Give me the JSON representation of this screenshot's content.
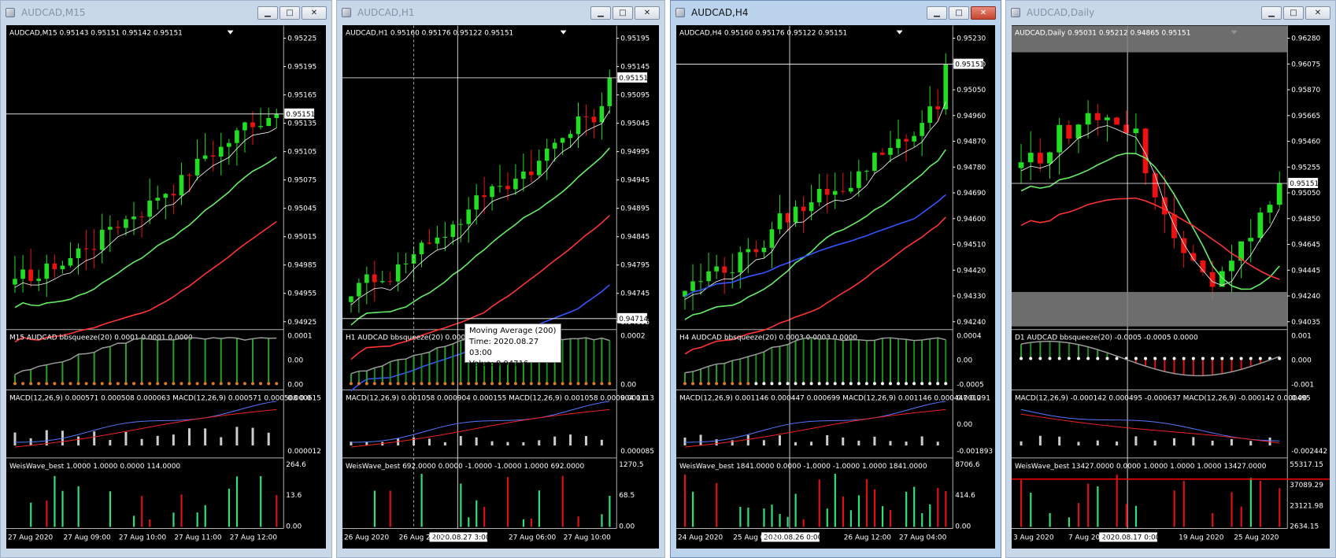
{
  "windows": [
    {
      "title": "AUDCAD,M15",
      "active": false,
      "header": "AUDCAD,M15  0.95143 0.95151 0.95142 0.95151",
      "price_ticks": [
        "0.95225",
        "0.95195",
        "0.95165",
        "0.95135",
        "0.95105",
        "0.95075",
        "0.95045",
        "0.95015",
        "0.94985",
        "0.94955",
        "0.94925"
      ],
      "price_min": 0.9491,
      "price_max": 0.9524,
      "current_price": "0.95151",
      "current_value": 0.95151,
      "indicator_label": "M15 AUDCAD bbsqueeze(20) 0.0001 0.0001 0.0000",
      "indicator_ticks": [
        "0.0001",
        "0.00",
        "0.00"
      ],
      "macd_label": "MACD(12,26,9) 0.000571 0.000508 0.000063  MACD(12,26,9) 0.000571 0.000508 0.0",
      "macd_ticks": [
        "0.000615",
        "0.000012"
      ],
      "weis_label": "WeisWave_best 1.0000 1.0000 0.0000 114.0000",
      "weis_ticks": [
        "264.6",
        "13.6",
        "0.00"
      ],
      "time_labels": [
        "27 Aug 2020",
        "27 Aug 09:00",
        "27 Aug 10:00",
        "27 Aug 11:00",
        "27 Aug 12:00"
      ],
      "crosshair_time": "",
      "trend": "up"
    },
    {
      "title": "AUDCAD,H1",
      "active": false,
      "header": "AUDCAD,H1  0.95160 0.95176 0.95122 0.95151",
      "price_ticks": [
        "0.95195",
        "0.95145",
        "0.95095",
        "0.95045",
        "0.94995",
        "0.94945",
        "0.94895",
        "0.94845",
        "0.94795",
        "0.94745",
        "0.94695"
      ],
      "price_min": 0.9468,
      "price_max": 0.9523,
      "current_price": "0.95151",
      "current_value": 0.95151,
      "crosshair_price": "0.94714",
      "indicator_label": "H1 AUDCAD bbsqueeze(20) 0.0002",
      "indicator_ticks": [
        "0.0002",
        "0.00"
      ],
      "macd_label": "MACD(12,26,9) 0.001058 0.000904 0.000155  MACD(12,26,9) 0.001058 0.000904 0.0",
      "macd_ticks": [
        "0.001113",
        "0.000085"
      ],
      "weis_label": "WeisWave_best 692.0000 0.0000 -1.0000 -1.0000 1.0000 692.0000",
      "weis_ticks": [
        "1270.5",
        "68.5",
        "0.00"
      ],
      "time_labels": [
        "26 Aug 2020",
        "26 Aug 22:00",
        "",
        "27 Aug 06:00",
        "27 Aug 10:00"
      ],
      "crosshair_time": "2020.08.27 3:00",
      "tooltip": {
        "line1": "Moving Average (200)",
        "line2": "Time: 2020.08.27 03:00",
        "line3": "Value: 0.94716"
      },
      "trend": "up"
    },
    {
      "title": "AUDCAD,H4",
      "active": true,
      "header": "AUDCAD,H4  0.95160 0.95176 0.95122 0.95151",
      "price_ticks": [
        "0.95230",
        "0.95140",
        "0.95050",
        "0.94960",
        "0.94870",
        "0.94780",
        "0.94690",
        "0.94600",
        "0.94510",
        "0.94420",
        "0.94330",
        "0.94240"
      ],
      "price_min": 0.9422,
      "price_max": 0.9525,
      "current_price": "0.95151",
      "current_value": 0.95151,
      "indicator_label": "H4 AUDCAD bbsqueeze(20) 0.0003 0.0003 0.0000",
      "indicator_ticks": [
        "0.0004",
        "0.00",
        "-0.0005"
      ],
      "macd_label": "MACD(12,26,9) 0.001146 0.000447 0.000699  MACD(12,26,9) 0.001146 0.000447 0.0",
      "macd_ticks": [
        "0.001291",
        "0.00",
        "-0.001893"
      ],
      "weis_label": "WeisWave_best 1841.0000 0.0000 -1.0000 -1.0000 1.0000 1841.0000",
      "weis_ticks": [
        "8706.6",
        "414.6",
        "0.00"
      ],
      "time_labels": [
        "24 Aug 2020",
        "25 Aug 04:00",
        "",
        "26 Aug 12:00",
        "27 Aug 04:00"
      ],
      "crosshair_time": "2020.08.26 0:00",
      "trend": "up"
    },
    {
      "title": "AUDCAD,Daily",
      "active": false,
      "header": "AUDCAD,Daily  0.95031 0.95212 0.94865 0.95151",
      "price_ticks": [
        "0.96280",
        "0.96075",
        "0.95870",
        "0.95665",
        "0.95460",
        "0.95255",
        "0.95050",
        "0.94850",
        "0.94645",
        "0.94445",
        "0.94240",
        "0.94035"
      ],
      "price_min": 0.9396,
      "price_max": 0.964,
      "current_price": "0.95151",
      "current_value": 0.95151,
      "indicator_label": "D1 AUDCAD bbsqueeze(20) -0.0005 -0.0005 0.0000",
      "indicator_ticks": [
        "0.001",
        "0.000",
        "-0.001"
      ],
      "macd_label": "MACD(12,26,9) -0.000142 0.000495 -0.000637  MACD(12,26,9) -0.000142 0.000495",
      "macd_ticks": [
        "0.00",
        "-0.002442"
      ],
      "weis_label": "WeisWave_best 13427.0000 0.0000 1.0000 1.0000 1.0000 13427.0000",
      "weis_ticks": [
        "55317.15",
        "37089.29",
        "23121.98",
        "2634.15"
      ],
      "time_labels": [
        "3 Aug 2020",
        "7 Aug 2020",
        "",
        "19 Aug 2020",
        "25 Aug 2020"
      ],
      "crosshair_time": "2020.08.17 0:00",
      "trend": "range"
    }
  ]
}
